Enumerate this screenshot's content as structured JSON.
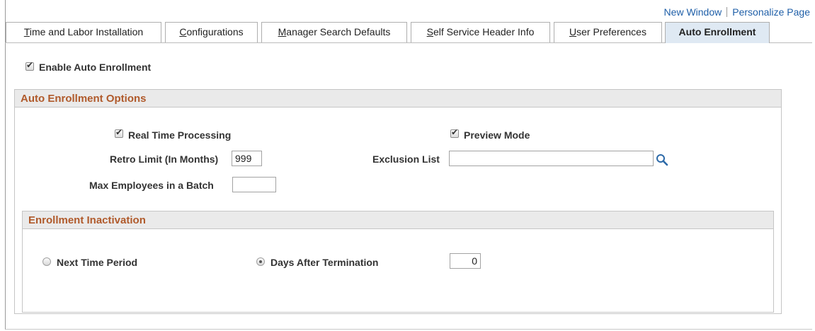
{
  "toplinks": {
    "new_window": "New Window",
    "personalize_page": "Personalize Page"
  },
  "tabs": [
    {
      "key": "T",
      "rest": "ime and Labor Installation"
    },
    {
      "key": "C",
      "rest": "onfigurations"
    },
    {
      "key": "M",
      "rest": "anager Search Defaults"
    },
    {
      "key": "S",
      "rest": "elf Service Header Info"
    },
    {
      "key": "U",
      "rest": "ser Preferences"
    },
    {
      "key": "",
      "rest": "Auto Enrollment"
    }
  ],
  "enable_auto_enrollment": {
    "label": "Enable Auto Enrollment",
    "checked": true
  },
  "options": {
    "title": "Auto Enrollment Options",
    "real_time_processing": {
      "label": "Real Time Processing",
      "checked": true
    },
    "preview_mode": {
      "label": "Preview Mode",
      "checked": true
    },
    "retro_limit": {
      "label": "Retro Limit (In Months)",
      "value": "999"
    },
    "exclusion_list": {
      "label": "Exclusion List",
      "value": ""
    },
    "max_employees": {
      "label": "Max Employees in a Batch",
      "value": ""
    }
  },
  "inactivation": {
    "title": "Enrollment Inactivation",
    "next_time_period": {
      "label": "Next Time Period",
      "selected": false
    },
    "days_after_termination": {
      "label": "Days After Termination",
      "selected": true,
      "value": "0"
    }
  },
  "colors": {
    "link": "#1f5fa8",
    "group_title": "#b05a2b",
    "active_tab": "#dfe9f3"
  }
}
